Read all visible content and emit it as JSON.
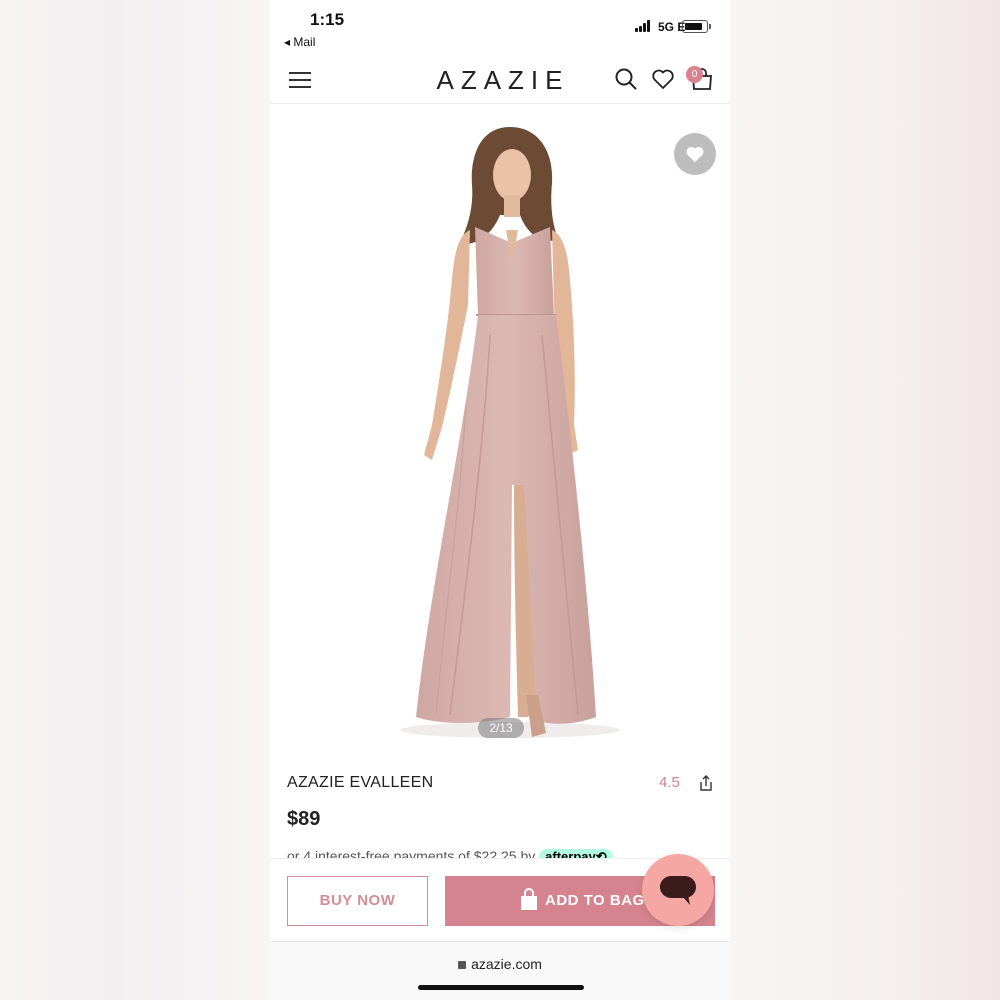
{
  "status_bar": {
    "time": "1:15",
    "back_app": "◂ Mail",
    "network": "5G E"
  },
  "header": {
    "logo": "AZAZIE",
    "cart_count": "0"
  },
  "gallery": {
    "counter": "2/13"
  },
  "product": {
    "name": "AZAZIE EVALLEEN",
    "rating": "4.5",
    "price": "$89",
    "installments_text": "or 4 interest-free payments of $22.25 by",
    "afterpay_label": "afterpay⟲"
  },
  "actions": {
    "buy_now": "BUY NOW",
    "add_to_bag": "ADD TO BAG"
  },
  "browser": {
    "url": "azazie.com"
  },
  "colors": {
    "accent": "#d5848f",
    "rating": "#d4808e",
    "chat": "#f5a8a3",
    "dress": "#d9b3ae"
  }
}
